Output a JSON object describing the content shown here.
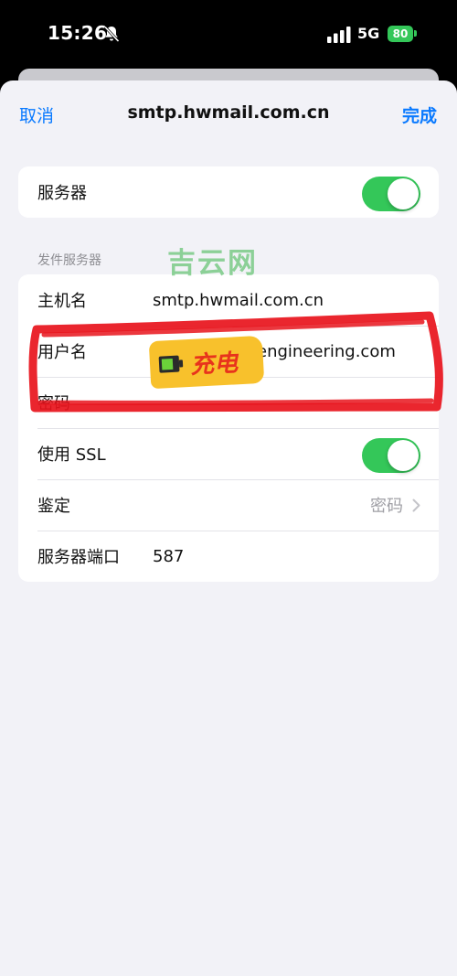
{
  "status_bar": {
    "time": "15:26",
    "network": "5G",
    "battery": "80"
  },
  "nav": {
    "cancel": "取消",
    "title": "smtp.hwmail.com.cn",
    "done": "完成"
  },
  "server_toggle": {
    "label": "服务器",
    "on": true
  },
  "outgoing": {
    "section_header": "发件服务器",
    "host_label": "主机名",
    "host_value": "smtp.hwmail.com.cn",
    "username_label": "用户名",
    "username_value_visible": "engineering.com",
    "password_label": "密码",
    "ssl_label": "使用 SSL",
    "ssl_on": true,
    "auth_label": "鉴定",
    "auth_value": "密码",
    "port_label": "服务器端口",
    "port_value": "587"
  },
  "overlay": {
    "watermark": "吉云网",
    "sticker": "充电"
  },
  "colors": {
    "accent": "#0a7aff",
    "toggle_on": "#34c759",
    "redaction": "#e8141c",
    "sticker": "#f8c12c"
  }
}
